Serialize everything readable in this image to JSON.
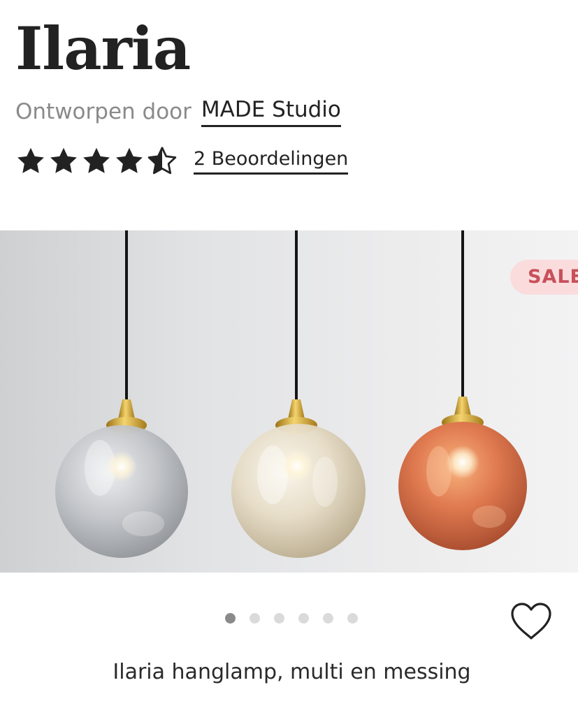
{
  "product": {
    "title": "Ilaria",
    "designer_prefix": "Ontworpen door",
    "designer_name": "MADE Studio",
    "rating": 4.5,
    "rating_max": 5,
    "reviews_label": "2 Beoordelingen",
    "caption": "Ilaria hanglamp, multi en messing"
  },
  "gallery": {
    "badge": "SALE",
    "image_count": 6,
    "active_index": 0,
    "lamps": [
      {
        "name": "smoke-glass-globe",
        "color": "#b9bcc0"
      },
      {
        "name": "amber-glass-globe",
        "color": "#ddd2b9"
      },
      {
        "name": "copper-glass-globe",
        "color": "#d9704a"
      }
    ]
  },
  "icons": {
    "star": "star-icon",
    "half_star": "half-star-icon",
    "wishlist": "heart-outline-icon"
  },
  "colors": {
    "text": "#222222",
    "muted": "#8a8a8a",
    "sale_bg": "#fbdcdc",
    "sale_text": "#c8505a",
    "dot_active": "#8a8a8a",
    "dot_inactive": "#dadada"
  }
}
